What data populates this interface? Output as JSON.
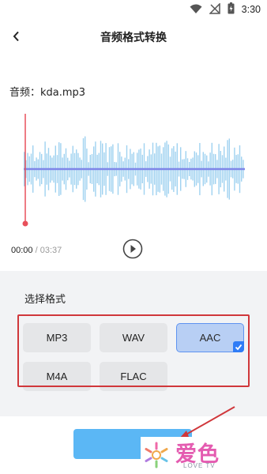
{
  "status_bar": {
    "time": "3:30"
  },
  "header": {
    "title": "音频格式转换"
  },
  "file": {
    "label": "音频：kda.mp3"
  },
  "player": {
    "current_time": "00:00",
    "separator": " / ",
    "total_time": "03:37"
  },
  "format_section": {
    "title": "选择格式",
    "options": [
      {
        "label": "MP3",
        "selected": false
      },
      {
        "label": "WAV",
        "selected": false
      },
      {
        "label": "AAC",
        "selected": true
      },
      {
        "label": "M4A",
        "selected": false
      },
      {
        "label": "FLAC",
        "selected": false
      }
    ]
  },
  "watermark": {
    "logo_text": "爱色",
    "sub_text": "LOVE TV"
  },
  "colors": {
    "accent": "#5bb7f5",
    "wave": "#9fd2f0",
    "playhead": "#e8505b",
    "selected_bg": "#b8cff4",
    "selected_border": "#5e93f0",
    "highlight": "#d0373b"
  }
}
